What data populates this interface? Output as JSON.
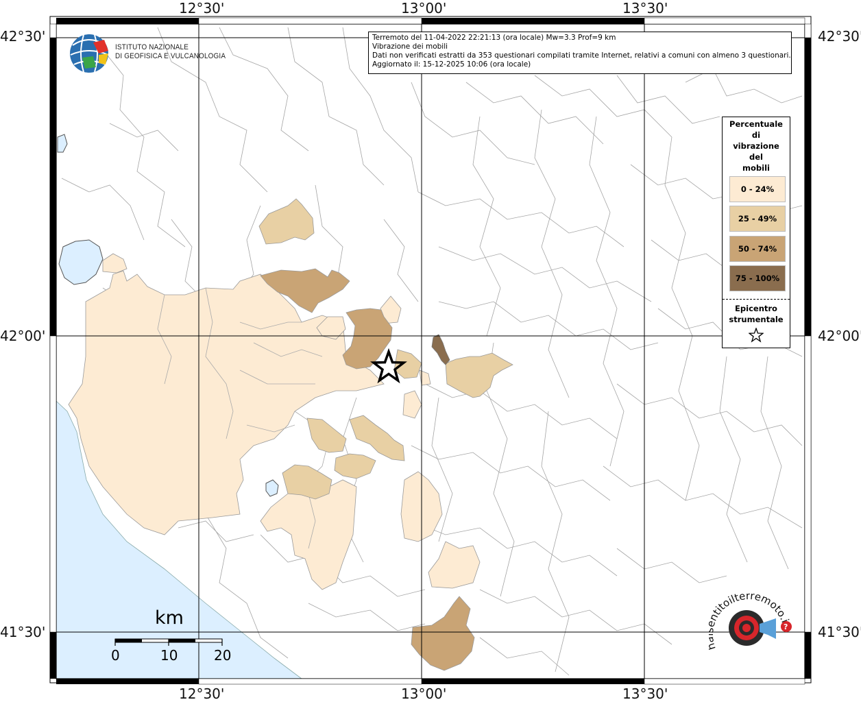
{
  "header_info": {
    "line1": "Terremoto del 11-04-2022 22:21:13 (ora locale) Mw=3.3 Prof=9 km",
    "line2": "Vibrazione dei mobili",
    "line3": "Dati non verificati estratti da 353 questionari compilati tramite Internet, relativi a comuni con almeno 3 questionari.",
    "line4": "Aggiornato il: 15-12-2025 10:06 (ora locale)"
  },
  "institute": {
    "line1": "ISTITUTO NAZIONALE",
    "line2": "DI GEOFISICA E VULCANOLOGIA"
  },
  "axes": {
    "top": [
      "12°30'",
      "13°00'",
      "13°30'"
    ],
    "bottom": [
      "12°30'",
      "13°00'",
      "13°30'"
    ],
    "left": [
      "42°30'",
      "42°00'",
      "41°30'"
    ],
    "right": [
      "42°30'",
      "42°00'",
      "41°30'"
    ]
  },
  "legend": {
    "title_lines": [
      "Percentuale",
      "di",
      "vibrazione",
      "del",
      "mobili"
    ],
    "classes": [
      {
        "label": "0 - 24%",
        "color": "#fdebd3"
      },
      {
        "label": "25 - 49%",
        "color": "#e8d0a4"
      },
      {
        "label": "50 - 74%",
        "color": "#c9a475"
      },
      {
        "label": "75 - 100%",
        "color": "#8a6d4e"
      }
    ],
    "epicenter_lines": [
      "Epicentro",
      "strumentale"
    ]
  },
  "scale_bar": {
    "unit": "km",
    "labels": [
      "0",
      "10",
      "20"
    ]
  },
  "colors": {
    "sea": "#dcefff",
    "land": "#ffffff",
    "boundary": "#9a9a9a",
    "grid": "#000000"
  },
  "logo_text": "haisentitoilterremoto.it"
}
